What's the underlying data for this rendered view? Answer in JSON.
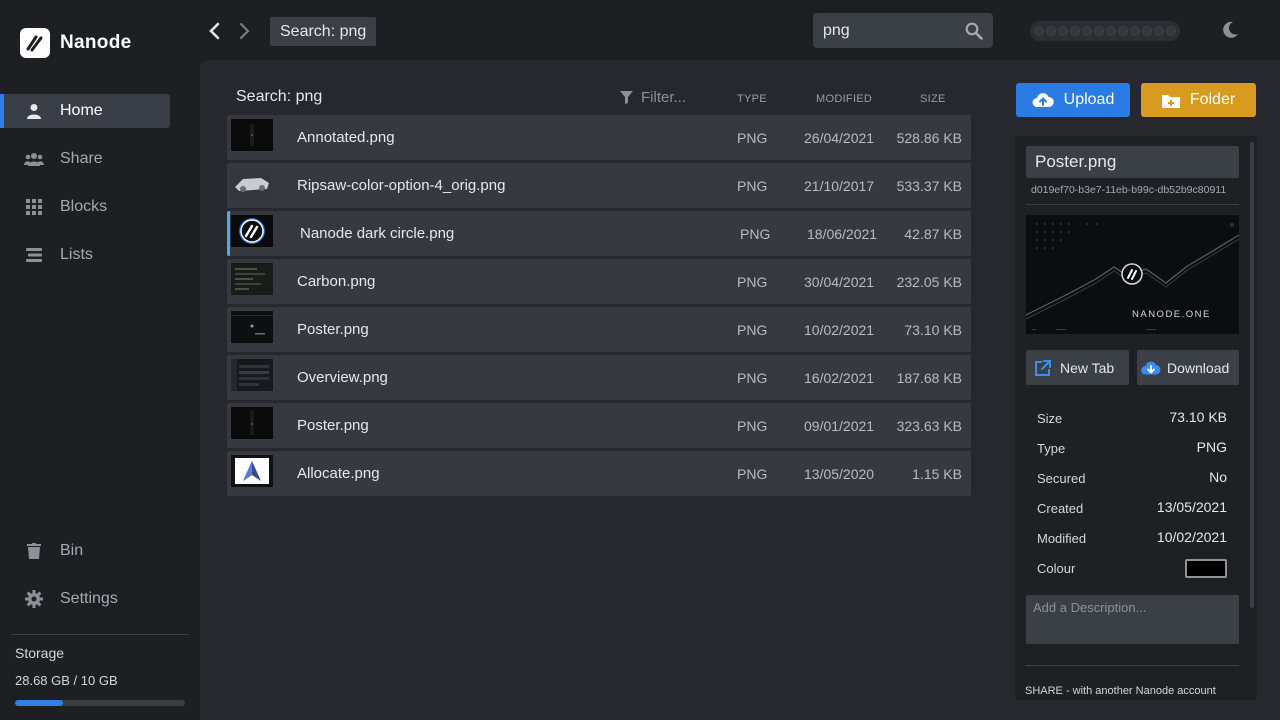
{
  "app": {
    "name": "Nanode"
  },
  "colors": {
    "accent": "#2f7fe6",
    "upload": "#2a7be4",
    "folder": "#d99a20",
    "selected_row": "#5aa0ea"
  },
  "sidebar": {
    "items": [
      {
        "label": "Home",
        "icon": "user-icon",
        "active": true
      },
      {
        "label": "Share",
        "icon": "users-icon",
        "active": false
      },
      {
        "label": "Blocks",
        "icon": "grid-icon",
        "active": false
      },
      {
        "label": "Lists",
        "icon": "list-icon",
        "active": false
      }
    ],
    "bottom": [
      {
        "label": "Bin",
        "icon": "trash-icon"
      },
      {
        "label": "Settings",
        "icon": "gear-icon"
      }
    ],
    "storage": {
      "title": "Storage",
      "value": "28.68 GB / 10 GB",
      "fill_fraction": 0.28
    }
  },
  "topbar": {
    "breadcrumb": "Search: png",
    "search_value": "png"
  },
  "list": {
    "title": "Search: png",
    "filter_placeholder": "Filter...",
    "columns": {
      "type": "TYPE",
      "modified": "MODIFIED",
      "size": "SIZE"
    },
    "rows": [
      {
        "name": "Annotated.png",
        "type": "PNG",
        "modified": "26/04/2021",
        "size": "528.86 KB",
        "thumb": "dark-poster",
        "selected": false
      },
      {
        "name": "Ripsaw-color-option-4_orig.png",
        "type": "PNG",
        "modified": "21/10/2017",
        "size": "533.37 KB",
        "thumb": "vehicle",
        "selected": false
      },
      {
        "name": "Nanode dark circle.png",
        "type": "PNG",
        "modified": "18/06/2021",
        "size": "42.87 KB",
        "thumb": "nanode-logo",
        "selected": true
      },
      {
        "name": "Carbon.png",
        "type": "PNG",
        "modified": "30/04/2021",
        "size": "232.05 KB",
        "thumb": "code",
        "selected": false
      },
      {
        "name": "Poster.png",
        "type": "PNG",
        "modified": "10/02/2021",
        "size": "73.10 KB",
        "thumb": "dark-wide",
        "selected": false
      },
      {
        "name": "Overview.png",
        "type": "PNG",
        "modified": "16/02/2021",
        "size": "187.68 KB",
        "thumb": "ui",
        "selected": false
      },
      {
        "name": "Poster.png",
        "type": "PNG",
        "modified": "09/01/2021",
        "size": "323.63 KB",
        "thumb": "dark-poster",
        "selected": false
      },
      {
        "name": "Allocate.png",
        "type": "PNG",
        "modified": "13/05/2020",
        "size": "1.15 KB",
        "thumb": "allocate-logo",
        "selected": false
      }
    ]
  },
  "actions": {
    "upload": "Upload",
    "folder": "Folder"
  },
  "details": {
    "name": "Poster.png",
    "id": "d019ef70-b3e7-11eb-b99c-db52b9c80911",
    "preview_text": "NANODE.ONE",
    "new_tab": "New Tab",
    "download": "Download",
    "props": [
      {
        "label": "Size",
        "value": "73.10 KB"
      },
      {
        "label": "Type",
        "value": "PNG"
      },
      {
        "label": "Secured",
        "value": "No"
      },
      {
        "label": "Created",
        "value": "13/05/2021"
      },
      {
        "label": "Modified",
        "value": "10/02/2021"
      }
    ],
    "colour_label": "Colour",
    "colour_value": "#000000",
    "description_placeholder": "Add a Description...",
    "share_note": "SHARE - with another Nanode account"
  }
}
